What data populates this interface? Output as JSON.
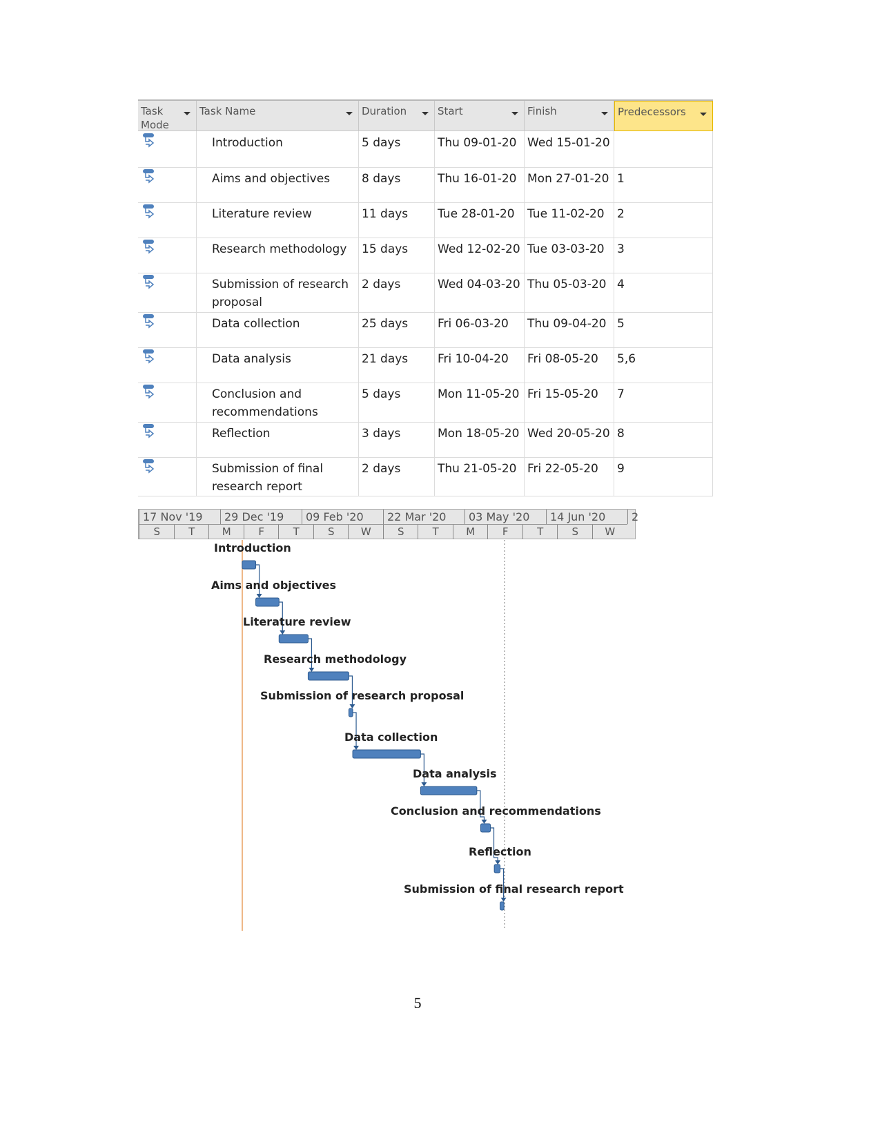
{
  "table": {
    "headers": {
      "mode": "Task Mode",
      "name": "Task Name",
      "duration": "Duration",
      "start": "Start",
      "finish": "Finish",
      "predecessors": "Predecessors"
    },
    "rows": [
      {
        "name": "Introduction",
        "duration": "5 days",
        "start": "Thu 09-01-20",
        "finish": "Wed 15-01-20",
        "pred": ""
      },
      {
        "name": "Aims and objectives",
        "duration": "8 days",
        "start": "Thu 16-01-20",
        "finish": "Mon 27-01-20",
        "pred": "1"
      },
      {
        "name": "Literature review",
        "duration": "11 days",
        "start": "Tue 28-01-20",
        "finish": "Tue 11-02-20",
        "pred": "2"
      },
      {
        "name": "Research methodology",
        "duration": "15 days",
        "start": "Wed 12-02-20",
        "finish": "Tue 03-03-20",
        "pred": "3"
      },
      {
        "name": "Submission of research proposal",
        "duration": "2 days",
        "start": "Wed 04-03-20",
        "finish": "Thu 05-03-20",
        "pred": "4"
      },
      {
        "name": "Data collection",
        "duration": "25 days",
        "start": "Fri 06-03-20",
        "finish": "Thu 09-04-20",
        "pred": "5"
      },
      {
        "name": "Data analysis",
        "duration": "21 days",
        "start": "Fri 10-04-20",
        "finish": "Fri 08-05-20",
        "pred": "5,6"
      },
      {
        "name": "Conclusion and recommendations",
        "duration": "5 days",
        "start": "Mon 11-05-20",
        "finish": "Fri 15-05-20",
        "pred": "7"
      },
      {
        "name": "Reflection",
        "duration": "3 days",
        "start": "Mon 18-05-20",
        "finish": "Wed 20-05-20",
        "pred": "8"
      },
      {
        "name": "Submission of final research report",
        "duration": "2 days",
        "start": "Thu 21-05-20",
        "finish": "Fri 22-05-20",
        "pred": "9"
      }
    ]
  },
  "timescale": {
    "major": [
      "17 Nov '19",
      "29 Dec '19",
      "09 Feb '20",
      "22 Mar '20",
      "03 May '20",
      "14 Jun '20",
      "2"
    ],
    "minor": [
      "S",
      "T",
      "M",
      "F",
      "T",
      "S",
      "W",
      "S",
      "T",
      "M",
      "F",
      "T",
      "S",
      "W"
    ]
  },
  "colors": {
    "bar": "#4f81bd",
    "bar_border": "#2c5a8f",
    "header_highlight": "#fde58a",
    "start_line": "#e8a060",
    "link": "#2c5a8f"
  },
  "page_number": "5"
}
